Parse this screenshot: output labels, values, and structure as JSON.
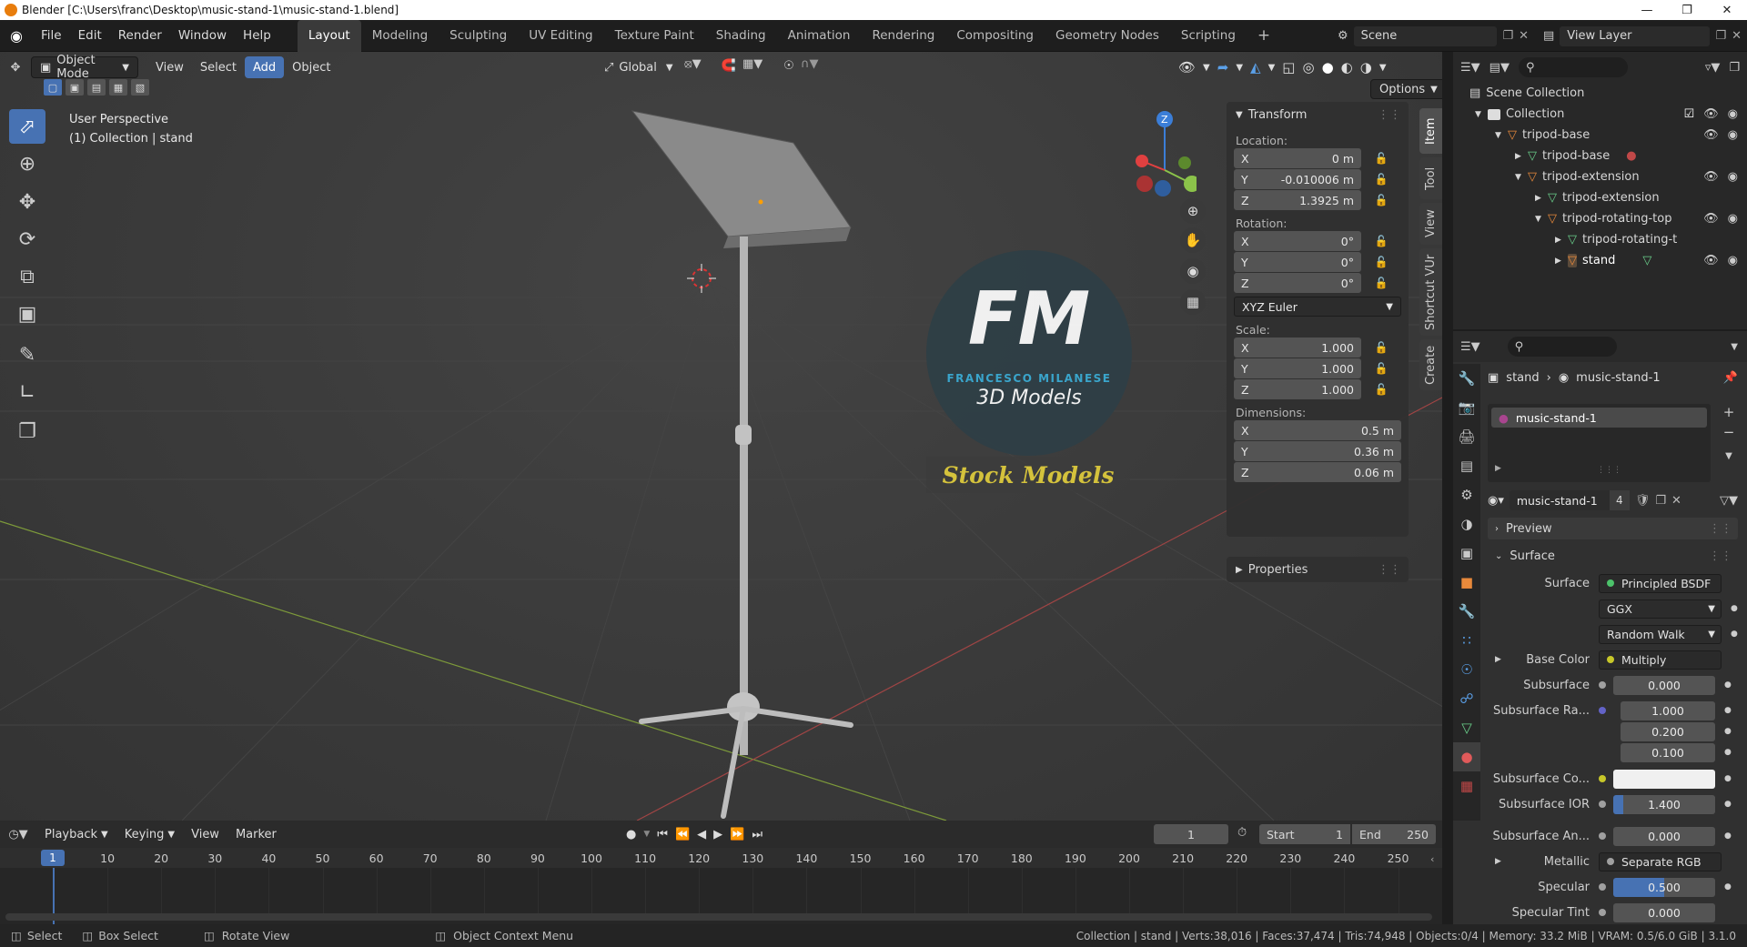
{
  "window": {
    "title": "Blender [C:\\Users\\franc\\Desktop\\music-stand-1\\music-stand-1.blend]"
  },
  "menu": {
    "items": [
      "File",
      "Edit",
      "Render",
      "Window",
      "Help"
    ]
  },
  "workspaces": [
    "Layout",
    "Modeling",
    "Sculpting",
    "UV Editing",
    "Texture Paint",
    "Shading",
    "Animation",
    "Rendering",
    "Compositing",
    "Geometry Nodes",
    "Scripting"
  ],
  "scene": {
    "name": "Scene",
    "view_layer": "View Layer"
  },
  "viewport": {
    "mode": "Object Mode",
    "menus": [
      "View",
      "Select",
      "Add",
      "Object"
    ],
    "orientation": "Global",
    "options_label": "Options",
    "overlay_line1": "User Perspective",
    "overlay_line2": "(1) Collection | stand",
    "gizmo_z": "Z",
    "logo_letters": "FM",
    "logo_name": "FRANCESCO MILANESE",
    "logo_sub": "3D Models",
    "stock_label": "Stock Models"
  },
  "npanel": {
    "tabs": [
      "Item",
      "Tool",
      "View",
      "Shortcut VUr",
      "Create"
    ],
    "transform_label": "Transform",
    "location_label": "Location:",
    "location": [
      {
        "axis": "X",
        "value": "0 m"
      },
      {
        "axis": "Y",
        "value": "-0.010006 m"
      },
      {
        "axis": "Z",
        "value": "1.3925 m"
      }
    ],
    "rotation_label": "Rotation:",
    "rotation": [
      {
        "axis": "X",
        "value": "0°"
      },
      {
        "axis": "Y",
        "value": "0°"
      },
      {
        "axis": "Z",
        "value": "0°"
      }
    ],
    "rotation_mode": "XYZ Euler",
    "scale_label": "Scale:",
    "scale": [
      {
        "axis": "X",
        "value": "1.000"
      },
      {
        "axis": "Y",
        "value": "1.000"
      },
      {
        "axis": "Z",
        "value": "1.000"
      }
    ],
    "dimensions_label": "Dimensions:",
    "dimensions": [
      {
        "axis": "X",
        "value": "0.5 m"
      },
      {
        "axis": "Y",
        "value": "0.36 m"
      },
      {
        "axis": "Z",
        "value": "0.06 m"
      }
    ],
    "properties_label": "Properties"
  },
  "outliner": {
    "scene_collection": "Scene Collection",
    "rows": [
      {
        "name": "Collection",
        "depth": 1,
        "kind": "collection"
      },
      {
        "name": "tripod-base",
        "depth": 2,
        "kind": "object"
      },
      {
        "name": "tripod-base",
        "depth": 3,
        "kind": "mesh"
      },
      {
        "name": "tripod-extension",
        "depth": 3,
        "kind": "object"
      },
      {
        "name": "tripod-extension",
        "depth": 4,
        "kind": "mesh"
      },
      {
        "name": "tripod-rotating-top",
        "depth": 4,
        "kind": "object"
      },
      {
        "name": "tripod-rotating-t",
        "depth": 5,
        "kind": "mesh"
      },
      {
        "name": "stand",
        "depth": 5,
        "kind": "object"
      }
    ]
  },
  "properties": {
    "breadcrumb_object": "stand",
    "breadcrumb_material": "music-stand-1",
    "slot_name": "music-stand-1",
    "material_name": "music-stand-1",
    "users": "4",
    "preview_label": "Preview",
    "surface_section": "Surface",
    "rows": [
      {
        "label": "Surface",
        "value": "Principled BSDF",
        "type": "link"
      },
      {
        "label": "",
        "value": "GGX",
        "type": "dropdown"
      },
      {
        "label": "",
        "value": "Random Walk",
        "type": "dropdown"
      },
      {
        "label": "Base Color",
        "value": "Multiply",
        "type": "link"
      },
      {
        "label": "Subsurface",
        "value": "0.000",
        "type": "number"
      },
      {
        "label": "Subsurface Ra...",
        "value": "1.000",
        "type": "number"
      },
      {
        "label": "",
        "value": "0.200",
        "type": "number"
      },
      {
        "label": "",
        "value": "0.100",
        "type": "number"
      },
      {
        "label": "Subsurface Co...",
        "value": "",
        "type": "color"
      },
      {
        "label": "Subsurface IOR",
        "value": "1.400",
        "type": "number"
      },
      {
        "label": "Subsurface An...",
        "value": "0.000",
        "type": "number"
      },
      {
        "label": "Metallic",
        "value": "Separate RGB",
        "type": "link"
      },
      {
        "label": "Specular",
        "value": "0.500",
        "type": "number"
      },
      {
        "label": "Specular Tint",
        "value": "0.000",
        "type": "number"
      }
    ]
  },
  "timeline": {
    "menus": [
      "Playback",
      "Keying",
      "View",
      "Marker"
    ],
    "current_frame": "1",
    "start_label": "Start",
    "start": "1",
    "end_label": "End",
    "end": "250",
    "ticks": [
      "1",
      "10",
      "20",
      "30",
      "40",
      "50",
      "60",
      "70",
      "80",
      "90",
      "100",
      "110",
      "120",
      "130",
      "140",
      "150",
      "160",
      "170",
      "180",
      "190",
      "200",
      "210",
      "220",
      "230",
      "240",
      "250"
    ]
  },
  "status": {
    "select": "Select",
    "box_select": "Box Select",
    "rotate_view": "Rotate View",
    "context_menu": "Object Context Menu",
    "stats": "Collection | stand | Verts:38,016 | Faces:37,474 | Tris:74,948 | Objects:0/4 | Memory: 33.2 MiB | VRAM: 0.5/6.0 GiB | 3.1.0"
  }
}
